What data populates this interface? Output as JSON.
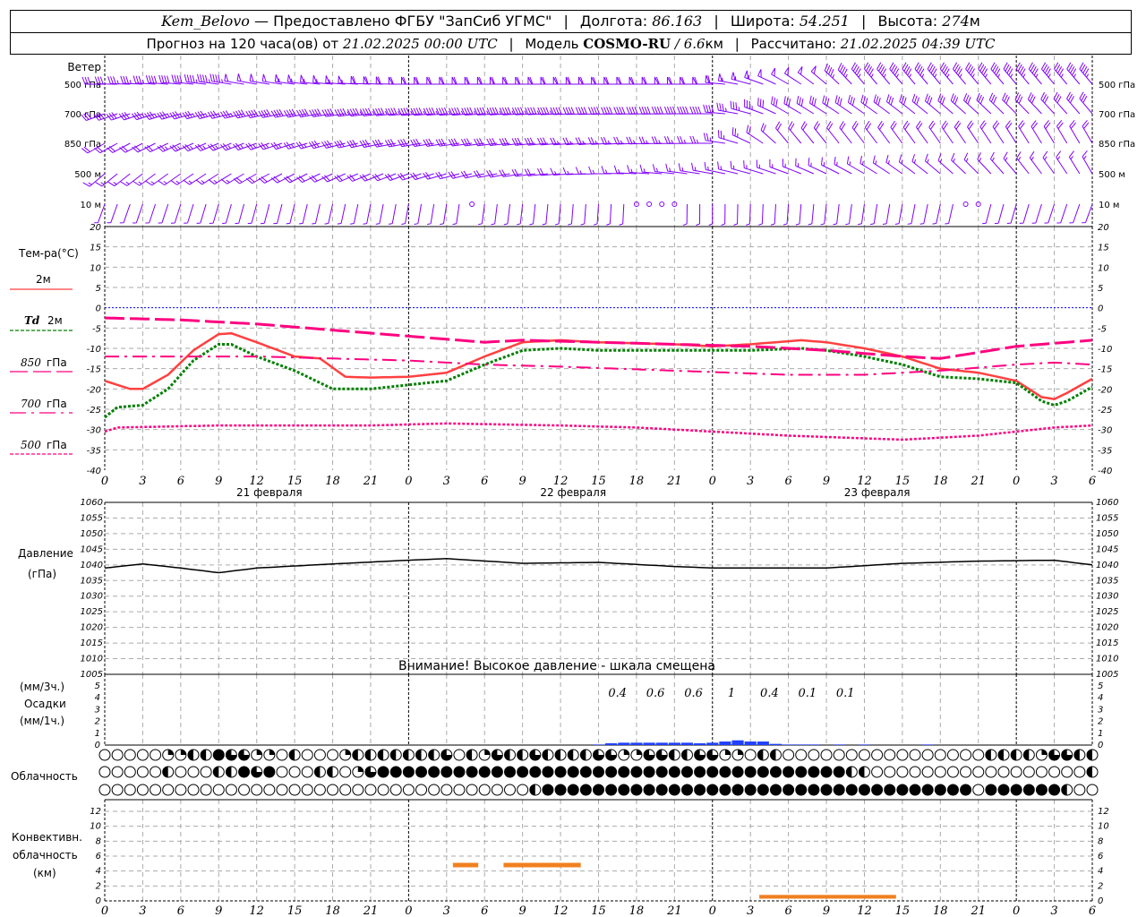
{
  "header": {
    "station": "Kem_Belovo",
    "dash": "—",
    "provider": "Предоставлено ФГБУ \"ЗапСиб УГМС\"",
    "lon_label": "Долгота:",
    "lon": "86.163",
    "lat_label": "Широта:",
    "lat": "54.251",
    "alt_label": "Высота:",
    "alt": "274",
    "alt_unit": "м",
    "forecast_label": "Прогноз на 120 часа(ов) от",
    "forecast_start": "21.02.2025 00:00 UTC",
    "model_label": "Модель",
    "model": "COSMO-RU",
    "resolution": "/ 6.6",
    "resolution_unit": "км",
    "computed_label": "Рассчитано:",
    "computed": "21.02.2025 04:39 UTC"
  },
  "labels": {
    "wind": "Ветер",
    "wind_levels": [
      "500 гПа",
      "700 гПа",
      "850 гПа",
      "500 м",
      "10  м"
    ],
    "temp_title": "Тем-ра(°C)",
    "legend_2m": "2м",
    "legend_td": "Td",
    "legend_td_2m": "2м",
    "legend_850": "850",
    "legend_700": "700",
    "legend_500": "500",
    "legend_hpa": "гПа",
    "pressure_title": "Давление",
    "pressure_unit": "(гПа)",
    "pressure_warning": "Внимание! Высокое давление - шкала смещена",
    "precip_unit3": "(мм/3ч.)",
    "precip_title": "Осадки",
    "precip_unit1": "(мм/1ч.)",
    "cloud_title": "Облачность",
    "conv_title1": "Конвективн.",
    "conv_title2": "облачность",
    "conv_unit": "(км)"
  },
  "colors": {
    "t2m": "#ff4040",
    "td2m": "#008000",
    "t850": "#ff0080",
    "t700": "#ff0080",
    "t500": "#ff0080",
    "zero_line": "#0000ff",
    "wind": "#8000ff",
    "precip": "#2040ff",
    "convective": "#f08020",
    "pressure": "#000000"
  },
  "chart_data": {
    "type": "line",
    "hours_range": [
      0,
      78
    ],
    "x_tick_labels": [
      "0",
      "3",
      "6",
      "9",
      "12",
      "15",
      "18",
      "21",
      "0",
      "3",
      "6",
      "9",
      "12",
      "15",
      "18",
      "21",
      "0",
      "3",
      "6",
      "9",
      "12",
      "15",
      "18",
      "21",
      "0",
      "3",
      "6"
    ],
    "dates": [
      {
        "hour": 13,
        "label": "21 февраля"
      },
      {
        "hour": 37,
        "label": "22 февраля"
      },
      {
        "hour": 61,
        "label": "23 февраля"
      }
    ],
    "wind": {
      "levels": [
        {
          "name": "500 гПа",
          "keys": [
            [
              0,
              270,
              30
            ],
            [
              12,
              280,
              50
            ],
            [
              24,
              270,
              60
            ],
            [
              48,
              270,
              60
            ],
            [
              54,
              300,
              50
            ],
            [
              60,
              320,
              45
            ],
            [
              78,
              320,
              45
            ]
          ]
        },
        {
          "name": "700 гПа",
          "keys": [
            [
              0,
              250,
              30
            ],
            [
              24,
              265,
              45
            ],
            [
              48,
              270,
              40
            ],
            [
              54,
              300,
              30
            ],
            [
              78,
              320,
              30
            ]
          ]
        },
        {
          "name": "850 гПа",
          "keys": [
            [
              0,
              240,
              20
            ],
            [
              24,
              260,
              30
            ],
            [
              48,
              270,
              25
            ],
            [
              54,
              320,
              20
            ],
            [
              78,
              330,
              20
            ]
          ]
        },
        {
          "name": "500 м",
          "keys": [
            [
              0,
              230,
              15
            ],
            [
              24,
              250,
              20
            ],
            [
              48,
              280,
              15
            ],
            [
              78,
              330,
              15
            ]
          ]
        },
        {
          "name": "10 м",
          "keys": [
            [
              0,
              200,
              5
            ],
            [
              24,
              190,
              5
            ],
            [
              48,
              180,
              5
            ],
            [
              78,
              200,
              5
            ]
          ],
          "calm_hours": [
            29,
            42,
            43,
            44,
            45,
            68,
            69
          ]
        }
      ]
    },
    "temperature": {
      "ylim": [
        -40,
        20
      ],
      "yticks": [
        20,
        15,
        10,
        5,
        0,
        -5,
        -10,
        -15,
        -20,
        -25,
        -30,
        -35,
        -40
      ],
      "series": [
        {
          "name": "2м",
          "style": "solid",
          "points": [
            [
              0,
              -18
            ],
            [
              2,
              -20
            ],
            [
              3,
              -20
            ],
            [
              5,
              -16.5
            ],
            [
              7,
              -10.5
            ],
            [
              9,
              -6.5
            ],
            [
              10,
              -6.3
            ],
            [
              12,
              -8.5
            ],
            [
              15,
              -12
            ],
            [
              17,
              -12.5
            ],
            [
              19,
              -17
            ],
            [
              21,
              -17.2
            ],
            [
              24,
              -17
            ],
            [
              27,
              -16
            ],
            [
              30,
              -12
            ],
            [
              33,
              -8.5
            ],
            [
              36,
              -8
            ],
            [
              39,
              -8.5
            ],
            [
              45,
              -9
            ],
            [
              48,
              -9.5
            ],
            [
              51,
              -9
            ],
            [
              55,
              -8
            ],
            [
              57,
              -8.5
            ],
            [
              60,
              -10
            ],
            [
              63,
              -12
            ],
            [
              66,
              -15
            ],
            [
              69,
              -16
            ],
            [
              72,
              -18
            ],
            [
              74,
              -22
            ],
            [
              75,
              -22.5
            ],
            [
              76,
              -21
            ],
            [
              78,
              -17.5
            ]
          ]
        },
        {
          "name": "Td 2м",
          "style": "dotted-thick",
          "points": [
            [
              0,
              -27
            ],
            [
              1,
              -24.5
            ],
            [
              3,
              -24
            ],
            [
              5,
              -20
            ],
            [
              7,
              -13
            ],
            [
              9,
              -9
            ],
            [
              10,
              -9
            ],
            [
              12,
              -12
            ],
            [
              15,
              -15.5
            ],
            [
              18,
              -20
            ],
            [
              21,
              -20
            ],
            [
              24,
              -19
            ],
            [
              27,
              -18
            ],
            [
              30,
              -14
            ],
            [
              33,
              -10.5
            ],
            [
              36,
              -10
            ],
            [
              39,
              -10.5
            ],
            [
              45,
              -10.5
            ],
            [
              51,
              -10.5
            ],
            [
              55,
              -10
            ],
            [
              57,
              -10.5
            ],
            [
              60,
              -12
            ],
            [
              63,
              -14
            ],
            [
              66,
              -17
            ],
            [
              69,
              -17.5
            ],
            [
              72,
              -18.5
            ],
            [
              74,
              -23
            ],
            [
              75,
              -24
            ],
            [
              76,
              -23
            ],
            [
              78,
              -19.5
            ]
          ]
        },
        {
          "name": "850 гПа",
          "style": "long-dash",
          "points": [
            [
              0,
              -2.5
            ],
            [
              6,
              -3
            ],
            [
              12,
              -4
            ],
            [
              18,
              -5.5
            ],
            [
              24,
              -7
            ],
            [
              30,
              -8.5
            ],
            [
              33,
              -8
            ],
            [
              39,
              -8.5
            ],
            [
              45,
              -9
            ],
            [
              51,
              -9.5
            ],
            [
              57,
              -10.5
            ],
            [
              63,
              -12
            ],
            [
              66,
              -12.5
            ],
            [
              72,
              -9.5
            ],
            [
              78,
              -8
            ]
          ]
        },
        {
          "name": "700 гПа",
          "style": "dash-dot",
          "points": [
            [
              0,
              -12
            ],
            [
              12,
              -12
            ],
            [
              24,
              -13
            ],
            [
              30,
              -14
            ],
            [
              36,
              -14.5
            ],
            [
              45,
              -15.5
            ],
            [
              54,
              -16.5
            ],
            [
              60,
              -16.5
            ],
            [
              66,
              -15.5
            ],
            [
              72,
              -14
            ],
            [
              75,
              -13.5
            ],
            [
              78,
              -14
            ]
          ]
        },
        {
          "name": "500 гПа",
          "style": "dotted",
          "points": [
            [
              0,
              -30.5
            ],
            [
              1,
              -29.5
            ],
            [
              9,
              -29
            ],
            [
              21,
              -29
            ],
            [
              27,
              -28.5
            ],
            [
              36,
              -29
            ],
            [
              42,
              -29.5
            ],
            [
              48,
              -30.5
            ],
            [
              54,
              -31.5
            ],
            [
              63,
              -32.5
            ],
            [
              69,
              -31.5
            ],
            [
              75,
              -29.5
            ],
            [
              78,
              -29
            ]
          ]
        }
      ]
    },
    "pressure": {
      "ylim": [
        1005,
        1060
      ],
      "yticks": [
        1060,
        1055,
        1050,
        1045,
        1040,
        1035,
        1030,
        1025,
        1020,
        1015,
        1010,
        1005
      ],
      "points": [
        [
          0,
          1039
        ],
        [
          3,
          1040.3
        ],
        [
          6,
          1039
        ],
        [
          9,
          1037.5
        ],
        [
          12,
          1039
        ],
        [
          18,
          1040.3
        ],
        [
          24,
          1041.5
        ],
        [
          27,
          1042
        ],
        [
          33,
          1040.5
        ],
        [
          39,
          1040.8
        ],
        [
          45,
          1039.5
        ],
        [
          48,
          1039
        ],
        [
          57,
          1039
        ],
        [
          63,
          1040.5
        ],
        [
          69,
          1041.2
        ],
        [
          75,
          1041.5
        ],
        [
          78,
          1040
        ]
      ]
    },
    "precipitation": {
      "ylim": [
        0,
        5
      ],
      "yticks": [
        5,
        4,
        3,
        2,
        1,
        0
      ],
      "hourly": [
        [
          39,
          0.05
        ],
        [
          40,
          0.15
        ],
        [
          41,
          0.2
        ],
        [
          42,
          0.2
        ],
        [
          43,
          0.2
        ],
        [
          44,
          0.2
        ],
        [
          45,
          0.2
        ],
        [
          46,
          0.2
        ],
        [
          47,
          0.15
        ],
        [
          48,
          0.2
        ],
        [
          49,
          0.3
        ],
        [
          50,
          0.4
        ],
        [
          51,
          0.3
        ],
        [
          52,
          0.3
        ],
        [
          53,
          0.1
        ],
        [
          54,
          0.05
        ],
        [
          55,
          0.05
        ],
        [
          56,
          0.05
        ],
        [
          58,
          0.05
        ],
        [
          60,
          0.05
        ],
        [
          65,
          0.05
        ]
      ],
      "sum3h": [
        {
          "hour": 40.5,
          "label": "0.4"
        },
        {
          "hour": 43.5,
          "label": "0.6"
        },
        {
          "hour": 46.5,
          "label": "0.6"
        },
        {
          "hour": 49.5,
          "label": "1"
        },
        {
          "hour": 52.5,
          "label": "0.4"
        },
        {
          "hour": 55.5,
          "label": "0.1"
        },
        {
          "hour": 58.5,
          "label": "0.1"
        }
      ]
    },
    "cloudiness": {
      "legend": "0=clear,1=quarter,2=half,3=three-quarter,4=overcast",
      "rows": [
        "0000011224331102000122222223021322322223311332233110220000000000000000222213322",
        "0000020002243400022013444444444444444444444444444444444444422000000000000000002434",
        "0000000000000000000000000000000000244444444444444444444444444444444440444444200"
      ]
    },
    "convective": {
      "ylim": [
        0,
        14
      ],
      "yticks": [
        12,
        10,
        8,
        6,
        4,
        2,
        0
      ],
      "bars": [
        {
          "from": 27.5,
          "to": 29.5,
          "base": 4.5,
          "top": 5.1
        },
        {
          "from": 31.5,
          "to": 37.6,
          "base": 4.5,
          "top": 5.1
        },
        {
          "from": 51.7,
          "to": 62.5,
          "base": 0.3,
          "top": 0.8
        }
      ]
    }
  }
}
